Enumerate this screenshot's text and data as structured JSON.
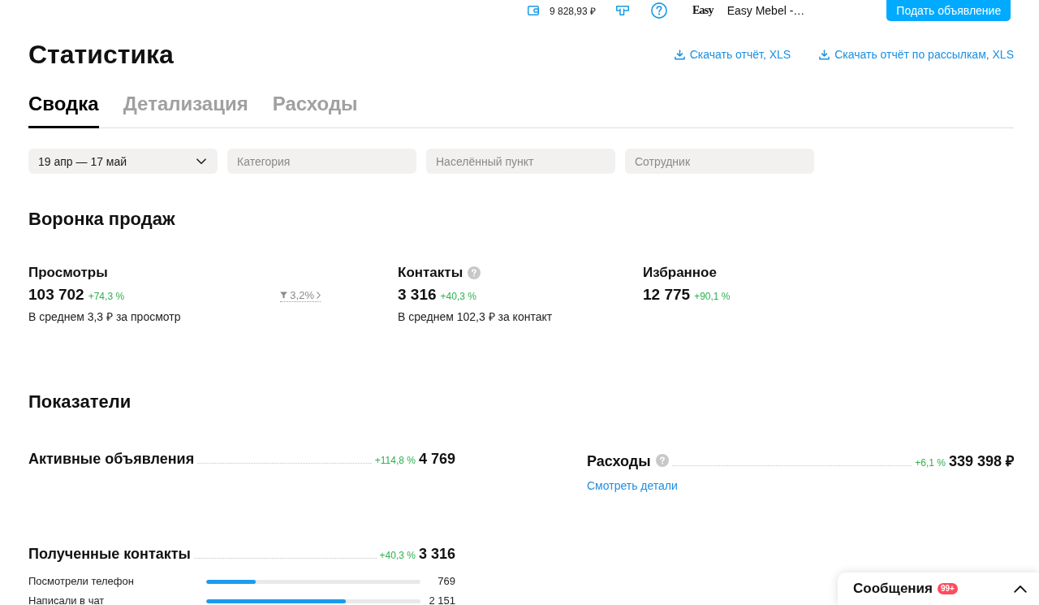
{
  "topbar": {
    "balance": "9 828,93 ₽",
    "logo_text": "Easy",
    "account_name": "Easy Mebel -…",
    "post_button": "Подать объявление"
  },
  "header": {
    "title": "Статистика",
    "download_links": [
      "Скачать отчёт, XLS",
      "Скачать отчёт по рассылкам, XLS"
    ]
  },
  "tabs": [
    {
      "label": "Сводка",
      "selected": true
    },
    {
      "label": "Детализация",
      "selected": false
    },
    {
      "label": "Расходы",
      "selected": false
    }
  ],
  "filters": [
    {
      "kind": "select",
      "value": "19 апр — 17 май"
    },
    {
      "kind": "input",
      "placeholder": "Категория"
    },
    {
      "kind": "input",
      "placeholder": "Населённый пункт"
    },
    {
      "kind": "input",
      "placeholder": "Сотрудник"
    }
  ],
  "funnel": {
    "title": "Воронка продаж",
    "stats": [
      {
        "label": "Просмотры",
        "help": false,
        "value": "103 702",
        "delta": "+74,3 %",
        "note": "В среднем 3,3 ₽ за просмотр",
        "conversion": "3,2%"
      },
      {
        "label": "Контакты",
        "help": true,
        "value": "3 316",
        "delta": "+40,3 %",
        "note": "В среднем 102,3 ₽ за контакт"
      },
      {
        "label": "Избранное",
        "help": false,
        "value": "12 775",
        "delta": "+90,1 %"
      }
    ]
  },
  "indicators": {
    "title": "Показатели",
    "columns": [
      {
        "items": [
          {
            "label": "Активные объявления",
            "help": false,
            "delta": "+114,8 %",
            "value": "4 769"
          },
          {
            "label": "Полученные контакты",
            "help": false,
            "delta": "+40,3 %",
            "value": "3 316",
            "breakdown": [
              {
                "label": "Посмотрели телефон",
                "level": 0.23,
                "value": "769"
              },
              {
                "label": "Написали в чат",
                "level": 0.65,
                "value": "2 151"
              }
            ]
          }
        ]
      },
      {
        "items": [
          {
            "label": "Расходы",
            "help": true,
            "delta": "+6,1 %",
            "value": "339 398 ₽",
            "link": "Смотреть детали"
          }
        ]
      }
    ]
  },
  "messages": {
    "title": "Сообщения",
    "badge": "99+"
  }
}
